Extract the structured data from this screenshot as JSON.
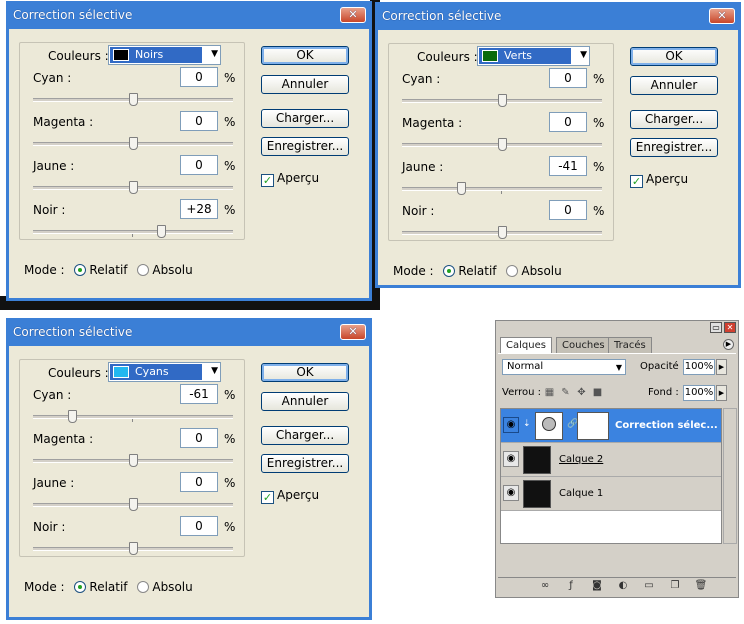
{
  "dialogs": [
    {
      "title": "Correction sélective",
      "close_label": "✕",
      "colors_label": "Couleurs :",
      "color_value": "Noirs",
      "swatch": "#000000",
      "sliders": [
        {
          "label": "Cyan :",
          "value": "0",
          "unit": "%",
          "level": 0
        },
        {
          "label": "Magenta :",
          "value": "0",
          "unit": "%",
          "level": 0
        },
        {
          "label": "Jaune :",
          "value": "0",
          "unit": "%",
          "level": 0
        },
        {
          "label": "Noir :",
          "value": "+28",
          "unit": "%",
          "level": 28
        }
      ],
      "buttons": {
        "ok": "OK",
        "cancel": "Annuler",
        "load": "Charger...",
        "save": "Enregistrer..."
      },
      "preview_label": "Aperçu",
      "preview_checked": true,
      "mode_label": "Mode :",
      "mode_relative": "Relatif",
      "mode_absolute": "Absolu"
    },
    {
      "title": "Correction sélective",
      "close_label": "✕",
      "colors_label": "Couleurs :",
      "color_value": "Verts",
      "swatch": "#0a6a0a",
      "sliders": [
        {
          "label": "Cyan :",
          "value": "0",
          "unit": "%",
          "level": 0
        },
        {
          "label": "Magenta :",
          "value": "0",
          "unit": "%",
          "level": 0
        },
        {
          "label": "Jaune :",
          "value": "-41",
          "unit": "%",
          "level": -41
        },
        {
          "label": "Noir :",
          "value": "0",
          "unit": "%",
          "level": 0
        }
      ],
      "buttons": {
        "ok": "OK",
        "cancel": "Annuler",
        "load": "Charger...",
        "save": "Enregistrer..."
      },
      "preview_label": "Aperçu",
      "preview_checked": true,
      "mode_label": "Mode :",
      "mode_relative": "Relatif",
      "mode_absolute": "Absolu"
    },
    {
      "title": "Correction sélective",
      "close_label": "✕",
      "colors_label": "Couleurs :",
      "color_value": "Cyans",
      "swatch": "#22b8f0",
      "sliders": [
        {
          "label": "Cyan :",
          "value": "-61",
          "unit": "%",
          "level": -61
        },
        {
          "label": "Magenta :",
          "value": "0",
          "unit": "%",
          "level": 0
        },
        {
          "label": "Jaune :",
          "value": "0",
          "unit": "%",
          "level": 0
        },
        {
          "label": "Noir :",
          "value": "0",
          "unit": "%",
          "level": 0
        }
      ],
      "buttons": {
        "ok": "OK",
        "cancel": "Annuler",
        "load": "Charger...",
        "save": "Enregistrer..."
      },
      "preview_label": "Aperçu",
      "preview_checked": true,
      "mode_label": "Mode :",
      "mode_relative": "Relatif",
      "mode_absolute": "Absolu"
    }
  ],
  "layers_panel": {
    "tabs": [
      "Calques",
      "Couches",
      "Tracés"
    ],
    "active_tab": "Calques",
    "blend_mode": "Normal",
    "opacity_label": "Opacité :",
    "opacity_value": "100%",
    "lock_label": "Verrou :",
    "fill_label": "Fond :",
    "fill_value": "100%",
    "layers": [
      {
        "name": "Correction sélec...",
        "selected": true,
        "type": "adjustment"
      },
      {
        "name": "Calque 2",
        "selected": false,
        "type": "pixel"
      },
      {
        "name": "Calque 1",
        "selected": false,
        "type": "pixel"
      }
    ],
    "footer_icons": [
      "link-icon",
      "fx-icon",
      "mask-icon",
      "adjustment-icon",
      "folder-icon",
      "new-layer-icon",
      "trash-icon"
    ]
  },
  "colors": {
    "title_bar": "#3b7fd6",
    "dialog_bg": "#ece9d8",
    "selection": "#316ac5"
  }
}
